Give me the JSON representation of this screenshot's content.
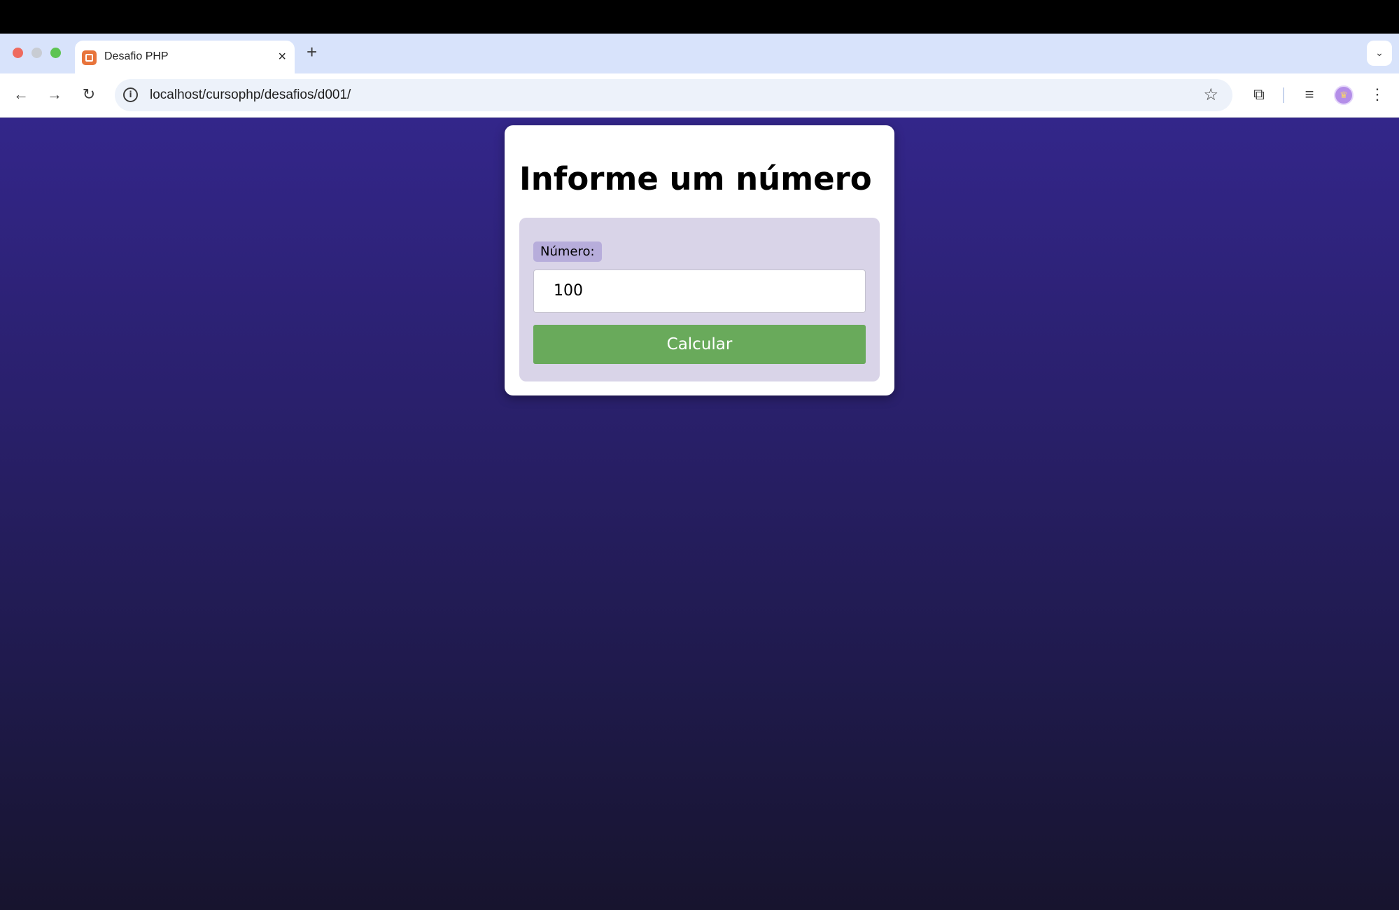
{
  "browser": {
    "tab_title": "Desafio PHP",
    "tab_close": "×",
    "new_tab": "+",
    "tab_menu": "⌄",
    "url": "localhost/cursophp/desafios/d001/",
    "icons": {
      "back": "←",
      "forward": "→",
      "reload": "↻",
      "info": "i",
      "star": "☆",
      "extensions": "⧉",
      "media": "≡",
      "menu": "⋮",
      "avatar": "♛"
    }
  },
  "page": {
    "heading": "Informe um número",
    "form": {
      "label": "Número:",
      "value": "100",
      "button": "Calcular"
    }
  },
  "colors": {
    "button": "#69aa5b",
    "form_bg": "#d9d4e8",
    "label_bg": "#b7addb",
    "bg_top": "#33268a",
    "bg_bottom": "#17142e"
  }
}
